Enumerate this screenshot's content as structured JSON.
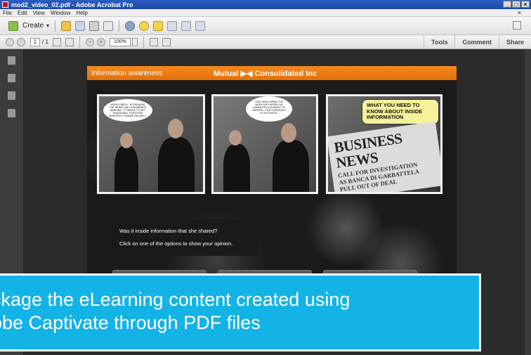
{
  "window": {
    "title": "mod2_video_02.pdf - Adobe Acrobat Pro",
    "buttons": [
      "_",
      "□",
      "×"
    ]
  },
  "menu": [
    "File",
    "Edit",
    "View",
    "Window",
    "Help"
  ],
  "menu_close": "×",
  "toolbar": {
    "create_label": "Create",
    "create_arrow": "▾"
  },
  "nav": {
    "current_page": "1",
    "page_total": "/ 1",
    "zoom": "100%",
    "minus": "−",
    "plus": "+"
  },
  "top_links": [
    "Tools",
    "Comment",
    "Share"
  ],
  "document": {
    "header_left": "Information awareness",
    "header_center": "Mutual ▶◀ Consolidated Inc",
    "bubble1": "WOULD BEEN - BY READING THE NEWS LIKE CONSIDERED BANKING - IT SEEMS TO GET AHEAD BAD. FOR A FEW MONTHS IT TURNED ON WELL.",
    "bubble2": "THAT WHAT WEAR THE BEAR WITH WORLD IN GARBATTELA IS ABOUT TO HAPPEN - THAT'S ENOUGH TO GO PUBLIC.",
    "note": "WHAT YOU NEED TO KNOW ABOUT INSIDE INFORMATION",
    "news_title": "BUSINESS NEWS",
    "news_sub1": "CALL FOR INVESTIGATION",
    "news_sub2": "AS BANCA DI GARBATTELA",
    "news_sub3": "PULL OUT OF DEAL",
    "question": "Was it inside information that she shared?",
    "instruction": "Click on one of the options to show your opinion."
  },
  "caption": {
    "line1": "ckage the eLearning content created using",
    "line2": "obe Captivate through PDF files"
  }
}
